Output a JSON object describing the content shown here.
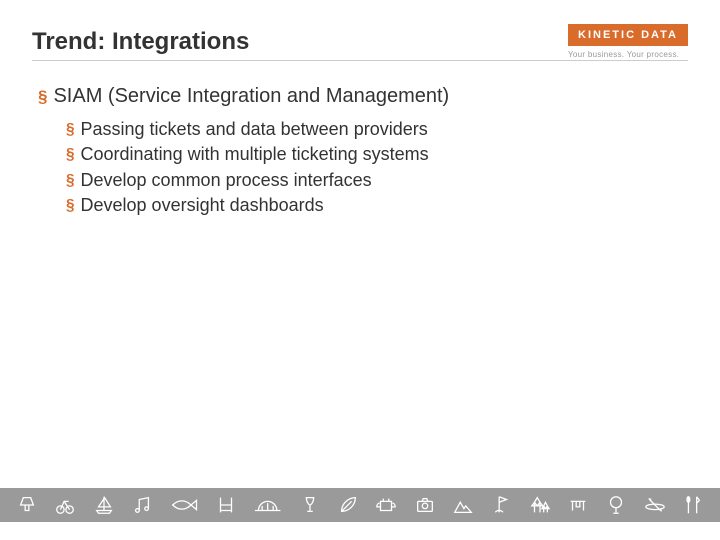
{
  "title": "Trend: Integrations",
  "logo": {
    "text": "KINETIC DATA",
    "tagline": "Your business. Your process."
  },
  "content": {
    "heading": "SIAM (Service Integration and Management)",
    "items": [
      "Passing tickets and data between providers",
      "Coordinating with multiple ticketing systems",
      "Develop common process interfaces",
      "Develop oversight dashboards"
    ]
  }
}
